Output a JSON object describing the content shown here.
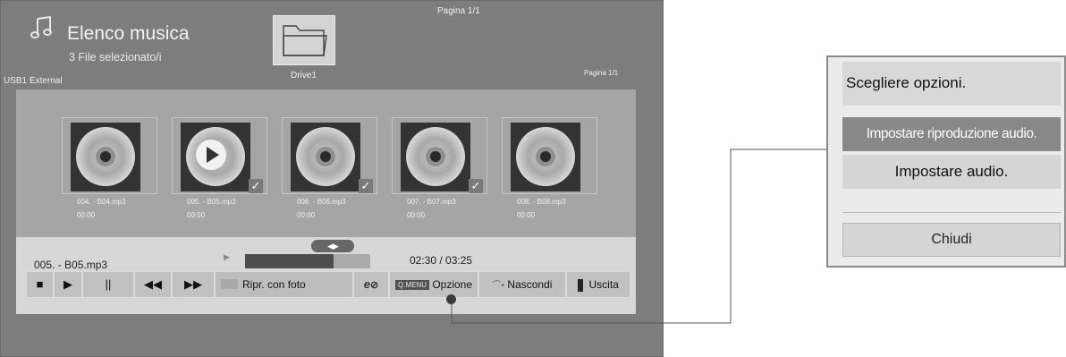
{
  "header": {
    "title": "Elenco musica",
    "subtitle": "3 File selezionato/i",
    "device": "USB1 External",
    "page_top": "Pagina 1/1",
    "page_right": "Pagina 1/1",
    "music_icon": "music-note-icon"
  },
  "drive": {
    "label": "Drive1",
    "icon": "folder-icon"
  },
  "thumbnails": [
    {
      "name": "004. - B04.mp3",
      "time": "00:00",
      "selected": false,
      "playing": false
    },
    {
      "name": "005. - B05.mp3",
      "time": "00:00",
      "selected": true,
      "playing": true
    },
    {
      "name": "006. - B06.mp3",
      "time": "00:00",
      "selected": true,
      "playing": false
    },
    {
      "name": "007. - B07.mp3",
      "time": "00:00",
      "selected": true,
      "playing": false
    },
    {
      "name": "008. - B08.mp3",
      "time": "00:00",
      "selected": false,
      "playing": false
    }
  ],
  "player": {
    "current_track": "005. - B05.mp3",
    "time": "02:30 / 03:25",
    "progress_fraction": 0.71,
    "controls": {
      "stop": "■",
      "play": "▶",
      "pause": "||",
      "rewind": "◀◀",
      "forward": "▶▶",
      "photo_label": "Ripr. con foto",
      "energy_label": "e",
      "qmenu_chip": "Q.MENU",
      "option_label": "Opzione",
      "hide_label": "Nascondi",
      "exit_label": "Uscita"
    },
    "seek_glyph": "◀▶",
    "check_glyph": "✓"
  },
  "dialog": {
    "title": "Scegliere opzioni.",
    "items": [
      "Impostare riproduzione audio.",
      "Impostare audio."
    ],
    "close_label": "Chiudi"
  },
  "colors": {
    "screen_bg": "#7d7d7d",
    "panel_bg": "#a5a5a5",
    "player_bg": "#d7d7d7",
    "highlight": "#888888"
  }
}
